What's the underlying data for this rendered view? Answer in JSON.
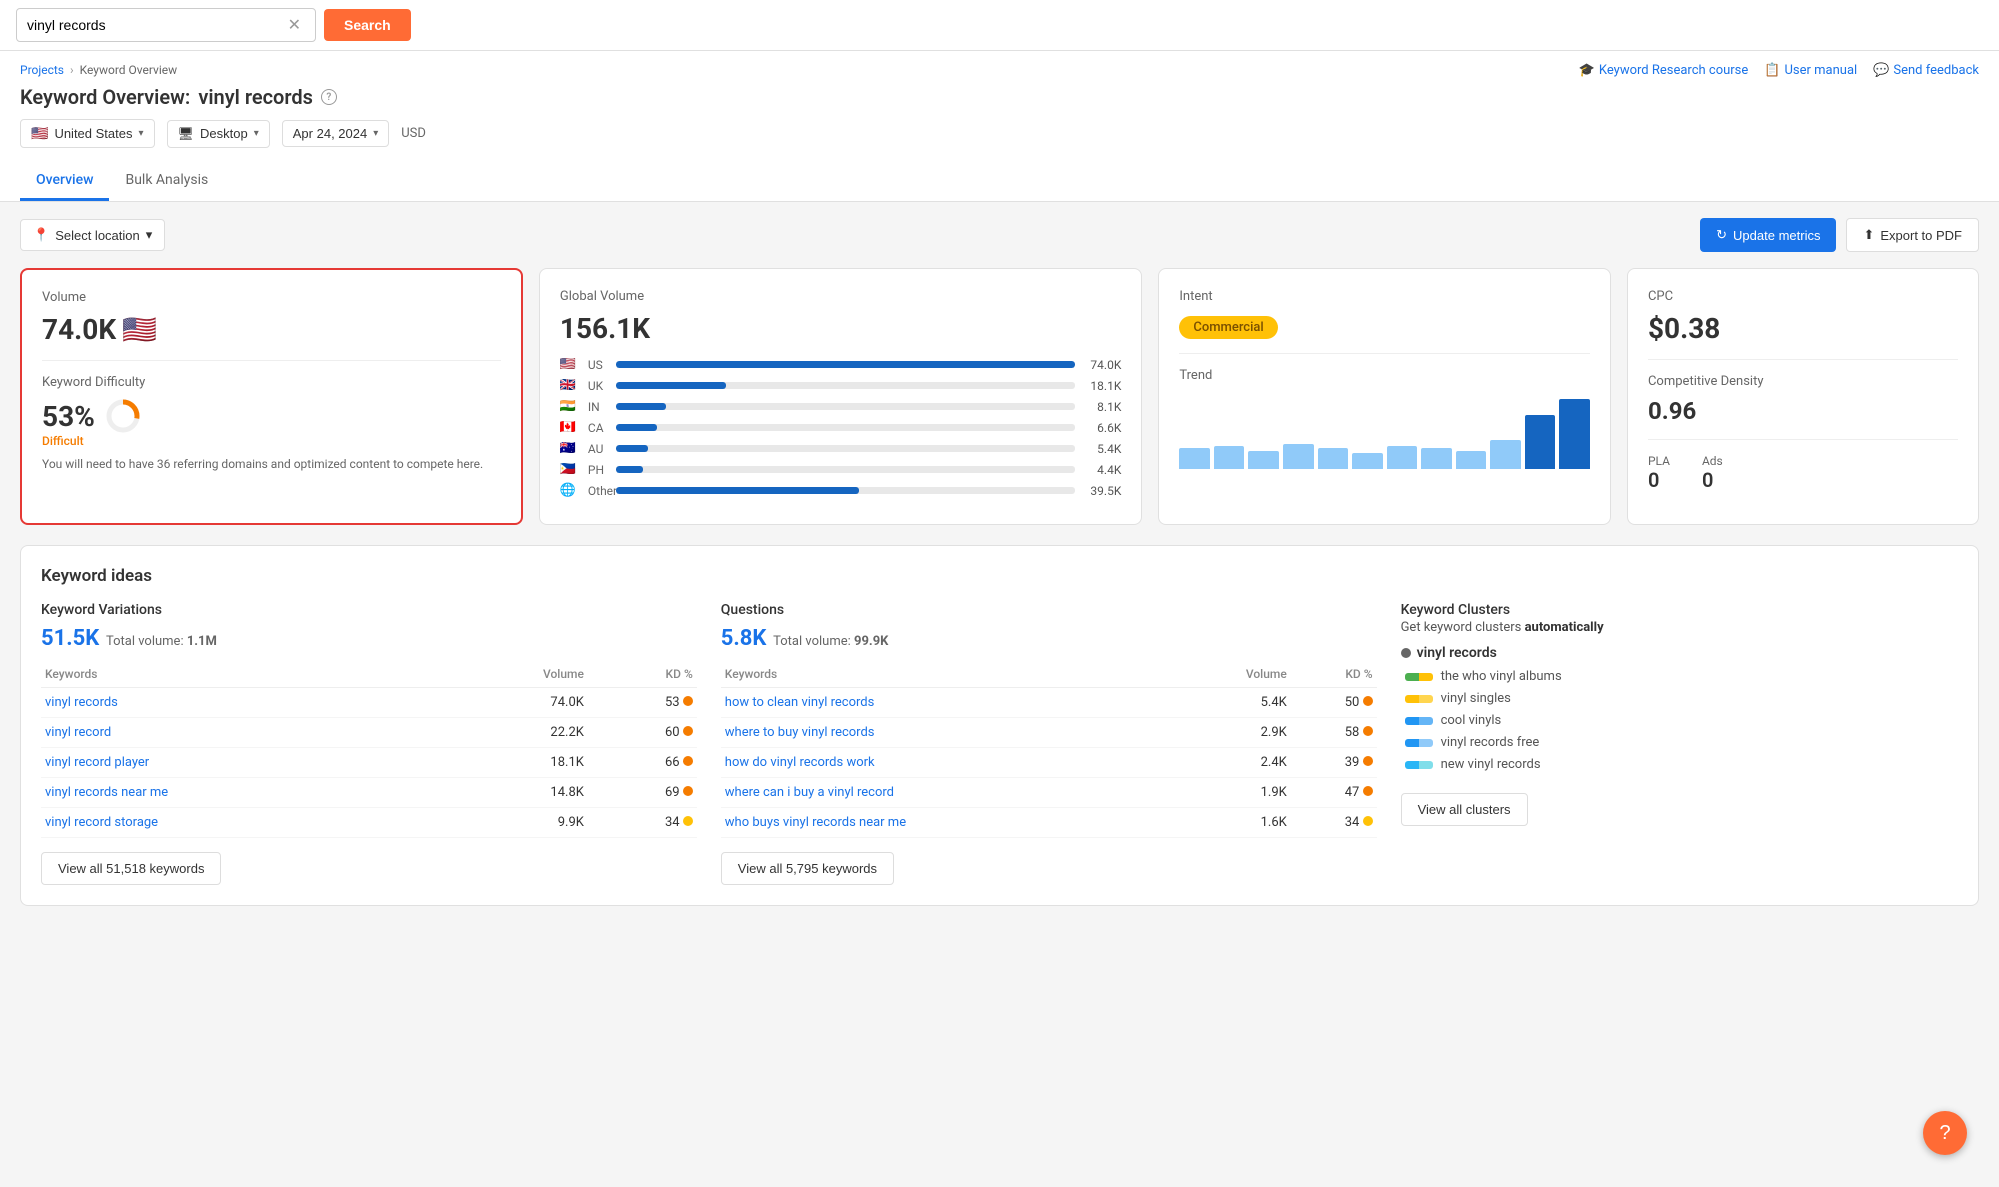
{
  "search": {
    "query": "vinyl records",
    "placeholder": "vinyl records",
    "button_label": "Search"
  },
  "breadcrumb": {
    "parent": "Projects",
    "current": "Keyword Overview"
  },
  "page": {
    "title_prefix": "Keyword Overview:",
    "title_keyword": "vinyl records"
  },
  "filters": {
    "country": "United States",
    "country_flag": "🇺🇸",
    "device": "Desktop",
    "date": "Apr 24, 2024",
    "currency": "USD"
  },
  "top_links": {
    "course": "Keyword Research course",
    "manual": "User manual",
    "feedback": "Send feedback"
  },
  "tabs": [
    {
      "label": "Overview",
      "active": true
    },
    {
      "label": "Bulk Analysis",
      "active": false
    }
  ],
  "toolbar": {
    "location_placeholder": "Select location",
    "update_btn": "Update metrics",
    "export_btn": "Export to PDF"
  },
  "volume_card": {
    "label": "Volume",
    "value": "74.0K",
    "flag": "🇺🇸",
    "kd_label": "Keyword Difficulty",
    "kd_value": "53%",
    "kd_status": "Difficult",
    "kd_percent": 53,
    "kd_desc": "You will need to have 36 referring domains and optimized content to compete here."
  },
  "global_volume_card": {
    "label": "Global Volume",
    "value": "156.1K",
    "countries": [
      {
        "flag": "🇺🇸",
        "code": "US",
        "value": "74.0K",
        "pct": 100
      },
      {
        "flag": "🇬🇧",
        "code": "UK",
        "value": "18.1K",
        "pct": 24
      },
      {
        "flag": "🇮🇳",
        "code": "IN",
        "value": "8.1K",
        "pct": 11
      },
      {
        "flag": "🇨🇦",
        "code": "CA",
        "value": "6.6K",
        "pct": 9
      },
      {
        "flag": "🇦🇺",
        "code": "AU",
        "value": "5.4K",
        "pct": 7
      },
      {
        "flag": "🇵🇭",
        "code": "PH",
        "value": "4.4K",
        "pct": 6
      },
      {
        "flag": "🌐",
        "code": "Other",
        "value": "39.5K",
        "pct": 53
      }
    ]
  },
  "intent_card": {
    "label": "Intent",
    "badge": "Commercial",
    "trend_label": "Trend",
    "trend_bars": [
      25,
      28,
      22,
      30,
      25,
      20,
      28,
      25,
      22,
      35,
      65,
      85
    ]
  },
  "cpc_card": {
    "cpc_label": "CPC",
    "cpc_value": "$0.38",
    "cd_label": "Competitive Density",
    "cd_value": "0.96",
    "pla_label": "PLA",
    "pla_value": "0",
    "ads_label": "Ads",
    "ads_value": "0"
  },
  "keyword_ideas": {
    "section_title": "Keyword ideas",
    "variations": {
      "title": "Keyword Variations",
      "count": "51.5K",
      "total_volume_label": "Total volume:",
      "total_volume": "1.1M",
      "col_keywords": "Keywords",
      "col_volume": "Volume",
      "col_kd": "KD %",
      "rows": [
        {
          "keyword": "vinyl records",
          "volume": "74.0K",
          "kd": 53,
          "kd_color": "orange"
        },
        {
          "keyword": "vinyl record",
          "volume": "22.2K",
          "kd": 60,
          "kd_color": "orange"
        },
        {
          "keyword": "vinyl record player",
          "volume": "18.1K",
          "kd": 66,
          "kd_color": "orange"
        },
        {
          "keyword": "vinyl records near me",
          "volume": "14.8K",
          "kd": 69,
          "kd_color": "orange"
        },
        {
          "keyword": "vinyl record storage",
          "volume": "9.9K",
          "kd": 34,
          "kd_color": "yellow"
        }
      ],
      "view_all_btn": "View all 51,518 keywords"
    },
    "questions": {
      "title": "Questions",
      "count": "5.8K",
      "total_volume_label": "Total volume:",
      "total_volume": "99.9K",
      "col_keywords": "Keywords",
      "col_volume": "Volume",
      "col_kd": "KD %",
      "rows": [
        {
          "keyword": "how to clean vinyl records",
          "volume": "5.4K",
          "kd": 50,
          "kd_color": "orange"
        },
        {
          "keyword": "where to buy vinyl records",
          "volume": "2.9K",
          "kd": 58,
          "kd_color": "orange"
        },
        {
          "keyword": "how do vinyl records work",
          "volume": "2.4K",
          "kd": 39,
          "kd_color": "orange"
        },
        {
          "keyword": "where can i buy a vinyl record",
          "volume": "1.9K",
          "kd": 47,
          "kd_color": "orange"
        },
        {
          "keyword": "who buys vinyl records near me",
          "volume": "1.6K",
          "kd": 34,
          "kd_color": "yellow"
        }
      ],
      "view_all_btn": "View all 5,795 keywords"
    },
    "clusters": {
      "title": "Keyword Clusters",
      "intro": "Get keyword clusters ",
      "intro_strong": "automatically",
      "parent": "vinyl records",
      "items": [
        {
          "label": "the who vinyl albums",
          "color1": "#4caf50",
          "color2": "#ffc107"
        },
        {
          "label": "vinyl singles",
          "color1": "#ffc107",
          "color2": "#ffd54f"
        },
        {
          "label": "cool vinyls",
          "color1": "#2196f3",
          "color2": "#64b5f6"
        },
        {
          "label": "vinyl records free",
          "color1": "#2196f3",
          "color2": "#90caf9"
        },
        {
          "label": "new vinyl records",
          "color1": "#29b6f6",
          "color2": "#80deea"
        }
      ],
      "view_all_btn": "View all clusters"
    }
  }
}
